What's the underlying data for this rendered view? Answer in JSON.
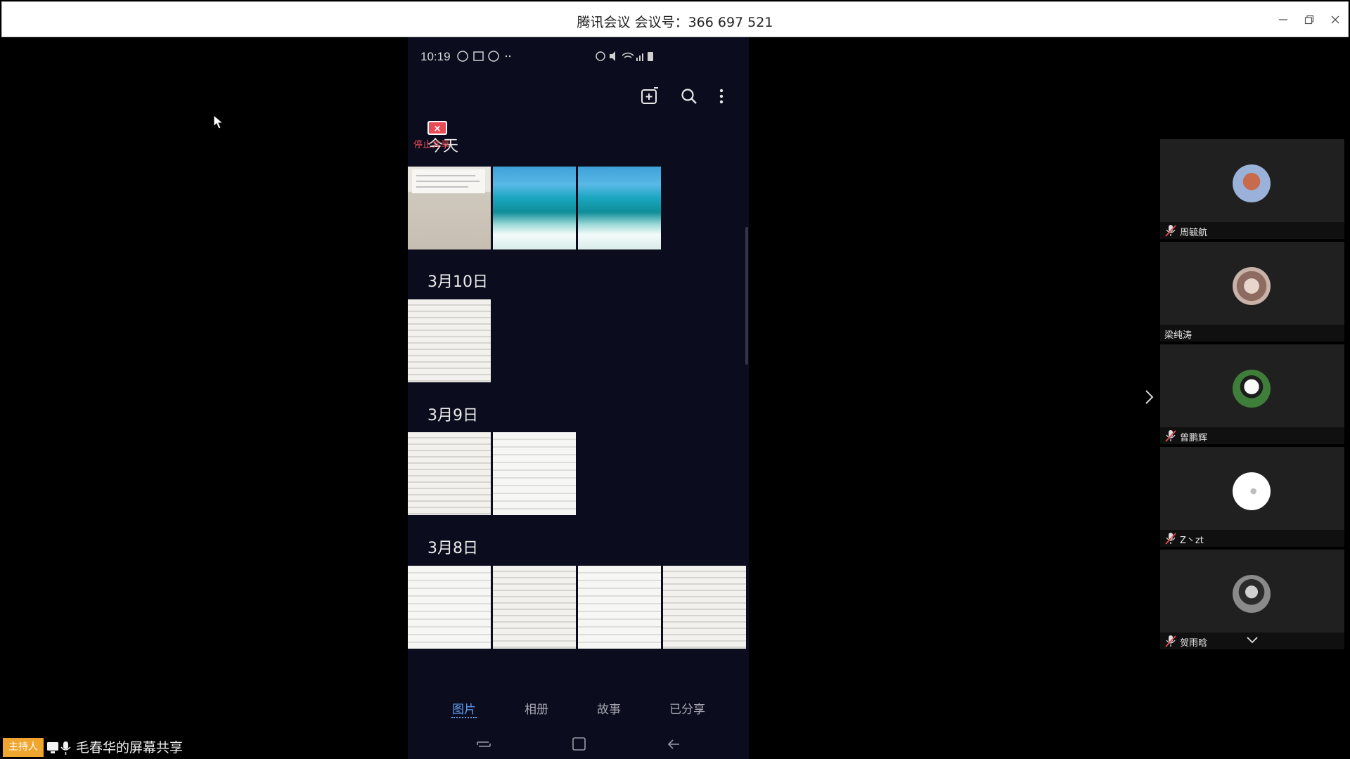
{
  "window": {
    "title": "腾讯会议 会议号：366 697 521"
  },
  "phone": {
    "status_bar": {
      "time": "10:19"
    },
    "stop_share": {
      "label": "停止共享"
    },
    "sections": [
      {
        "label": "今天"
      },
      {
        "label": "3月10日"
      },
      {
        "label": "3月9日"
      },
      {
        "label": "3月8日"
      }
    ],
    "bottom_tabs": [
      {
        "label": "图片",
        "active": true
      },
      {
        "label": "相册"
      },
      {
        "label": "故事"
      },
      {
        "label": "已分享"
      }
    ]
  },
  "participants": [
    {
      "name": "周毓航",
      "mic_icon": "mic-muted-icon"
    },
    {
      "name": "梁纯涛"
    },
    {
      "name": "曾鹏辉",
      "mic_icon": "mic-muted-icon"
    },
    {
      "name": "Z丶zt",
      "mic_icon": "mic-muted-icon"
    },
    {
      "name": "贺雨晗",
      "mic_icon": "mic-muted-icon"
    }
  ],
  "sharing": {
    "host_badge": "主持人",
    "label": "毛春华的屏幕共享"
  },
  "colors": {
    "host_badge": "#f0a52e",
    "active_tab": "#5f9cf0",
    "stop_share": "#e84b55",
    "phone_bg": "#0b0c1d"
  }
}
